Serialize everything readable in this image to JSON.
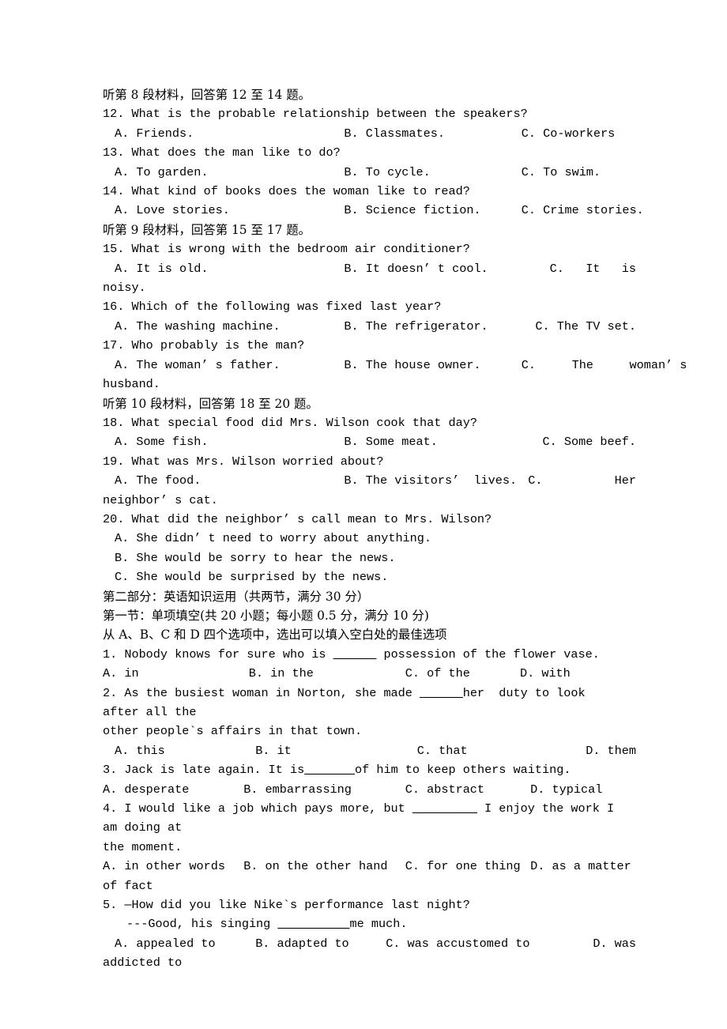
{
  "document": {
    "type": "exam-paper",
    "language": "zh-CN/en",
    "page_background": "#ffffff",
    "text_color": "#000000"
  },
  "listening": {
    "section_8_header": "听第 8 段材料，回答第 12 至 14 题。",
    "section_9_header": "听第 9 段材料，回答第 15 至 17 题。",
    "section_10_header": "听第 10 段材料，回答第 18 至 20 题。",
    "questions": [
      {
        "number": "12.",
        "stem": "12. What is the probable relationship between the speakers?",
        "a": "A. Friends.",
        "b": "B. Classmates.",
        "c": "C. Co-workers"
      },
      {
        "number": "13.",
        "stem": "13. What does the man like to do?",
        "a": "A. To garden.",
        "b": "B. To cycle.",
        "c": "C. To swim."
      },
      {
        "number": "14.",
        "stem": "14. What kind of books does the woman like to read?",
        "a": "A. Love stories.",
        "b": "B. Science fiction.",
        "c": "C. Crime stories."
      },
      {
        "number": "15.",
        "stem": "15. What is wrong with the bedroom air conditioner?",
        "a": "A. It is old.",
        "b": "B. It doesn’ t cool.",
        "c": "C.   It   is",
        "c_wrap": "noisy."
      },
      {
        "number": "16.",
        "stem": "16. Which of the following was fixed last year?",
        "a": "A. The washing machine.",
        "b": "B. The refrigerator.",
        "c": "C. The TV set."
      },
      {
        "number": "17.",
        "stem": "17. Who probably is the man?",
        "a": "A. The woman’ s father.",
        "b": "B. The house owner.",
        "c": "C.     The     woman’ s",
        "c_wrap": "husband."
      },
      {
        "number": "18.",
        "stem": "18. What special food did Mrs. Wilson cook that day?",
        "a": "A. Some fish.",
        "b": "B. Some meat.",
        "c": "C. Some beef."
      },
      {
        "number": "19.",
        "stem": "19. What was Mrs. Wilson worried about?",
        "a": "A. The food.",
        "b": "B. The visitors’  lives.",
        "c": "C.          Her",
        "c_wrap": "neighbor’ s cat."
      },
      {
        "number": "20.",
        "stem": "20. What did the neighbor’ s call mean to Mrs. Wilson?",
        "a": "A. She didn’ t need to worry about anything.",
        "b": "B. She would be sorry to hear the news.",
        "c": "C. She would be surprised by the news."
      }
    ]
  },
  "part_two": {
    "part_header": "第二部分：英语知识运用（共两节，满分 30 分）",
    "section_header": "第一节：单项填空(共 20 小题；每小题 0.5 分，满分 10 分)",
    "instruction": "从 A、B、C 和 D 四个选项中，选出可以填入空白处的最佳选项",
    "questions": [
      {
        "number": "1.",
        "stem_before": "1. Nobody knows for sure who is ",
        "blank": "______",
        "stem_after": " possession of the flower vase.",
        "a": "A. in",
        "b": "B. in the",
        "c": "C. of the",
        "d": "D. with"
      },
      {
        "number": "2.",
        "stem_before": "2. As the busiest woman in Norton, she made ",
        "blank": "______",
        "stem_after": "her  duty to look after all the",
        "stem_wrap": "other people`s affairs in that town.",
        "a": "A. this",
        "b": "B. it",
        "c": "C. that",
        "d": "D. them"
      },
      {
        "number": "3.",
        "stem_before": "3. Jack is late again. It is",
        "blank": "_______",
        "stem_after": "of him to keep others waiting.",
        "a": "A. desperate",
        "b": "B. embarrassing",
        "c": "C. abstract",
        "d": "D. typical"
      },
      {
        "number": "4.",
        "stem_before": "4. I would like a job which pays more, but ",
        "blank": "_________",
        "stem_after": " I enjoy the work I am doing at",
        "stem_wrap": "the moment.",
        "a": "A. in other words",
        "b": "B. on the other hand",
        "c": "C. for one thing",
        "d": "D. as a matter",
        "d_wrap": "of fact"
      },
      {
        "number": "5.",
        "stem": "5. —How did you like Nike`s performance last night?",
        "stem_line2_before": "---Good, his singing ",
        "blank": "__________",
        "stem_line2_after": "me much.",
        "a": "A. appealed to",
        "b": "B. adapted to",
        "c": "C. was accustomed to",
        "d": "D. was",
        "d_wrap": "addicted to"
      }
    ]
  }
}
